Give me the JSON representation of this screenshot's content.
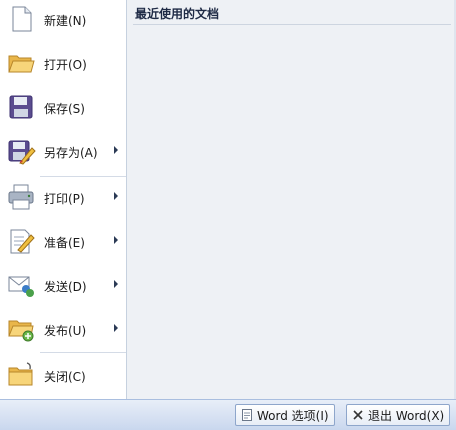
{
  "menu": {
    "items": [
      {
        "label": "新建(N)",
        "icon": "new-document-icon",
        "submenu": false
      },
      {
        "label": "打开(O)",
        "icon": "open-folder-icon",
        "submenu": false
      },
      {
        "label": "保存(S)",
        "icon": "save-floppy-icon",
        "submenu": false
      },
      {
        "label": "另存为(A)",
        "icon": "save-as-icon",
        "submenu": true
      },
      {
        "label": "打印(P)",
        "icon": "printer-icon",
        "submenu": true
      },
      {
        "label": "准备(E)",
        "icon": "prepare-document-icon",
        "submenu": true
      },
      {
        "label": "发送(D)",
        "icon": "send-icon",
        "submenu": true
      },
      {
        "label": "发布(U)",
        "icon": "publish-folder-icon",
        "submenu": true
      },
      {
        "label": "关闭(C)",
        "icon": "close-folder-icon",
        "submenu": false
      }
    ]
  },
  "recent": {
    "title": "最近使用的文档"
  },
  "footer": {
    "options_label": "Word 选项(I)",
    "exit_label": "退出 Word(X)"
  },
  "colors": {
    "accent": "#2b579a",
    "panel_bg": "#eef1f5",
    "bar_bg": "#c9d7ee"
  }
}
